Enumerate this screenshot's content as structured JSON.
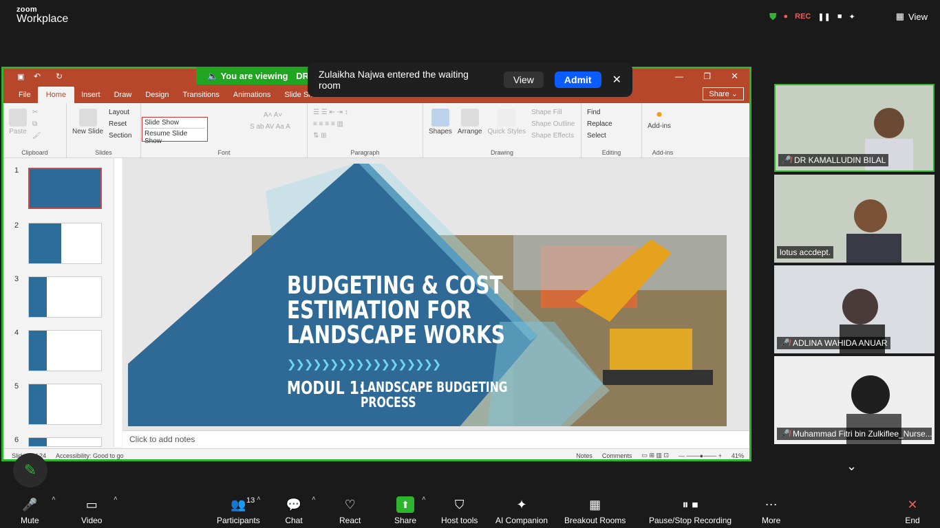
{
  "app": {
    "logo_line1": "zoom",
    "logo_line2": "Workplace"
  },
  "topbar": {
    "rec_label": "REC",
    "view_label": "View"
  },
  "banner": {
    "viewing_text": "You are viewing",
    "presenter_prefix": "DR"
  },
  "toast": {
    "message": "Zulaikha Najwa entered the waiting room",
    "view_label": "View",
    "admit_label": "Admit"
  },
  "ppt": {
    "tabs": [
      "File",
      "Home",
      "Insert",
      "Draw",
      "Design",
      "Transitions",
      "Animations",
      "Slide Show"
    ],
    "share_label": "Share",
    "ribbon": {
      "clipboard": {
        "paste": "Paste",
        "group": "Clipboard"
      },
      "slides": {
        "new_slide": "New Slide",
        "layout": "Layout",
        "reset": "Reset",
        "section": "Section",
        "group": "Slides"
      },
      "font": {
        "group": "Font"
      },
      "paragraph": {
        "group": "Paragraph"
      },
      "drawing": {
        "shapes": "Shapes",
        "arrange": "Arrange",
        "quick_styles": "Quick Styles",
        "shape_fill": "Shape Fill",
        "shape_outline": "Shape Outline",
        "shape_effects": "Shape Effects",
        "group": "Drawing"
      },
      "editing": {
        "find": "Find",
        "replace": "Replace",
        "select": "Select",
        "group": "Editing"
      },
      "addins": {
        "label": "Add-ins",
        "group": "Add-ins"
      }
    },
    "slideshow_popup": {
      "title": "Slide Show",
      "resume": "Resume Slide Show"
    },
    "thumbnails": [
      "1",
      "2",
      "3",
      "4",
      "5",
      "6"
    ],
    "slide": {
      "title_line1": "BUDGETING & COST",
      "title_line2": "ESTIMATION FOR",
      "title_line3": "LANDSCAPE WORKS",
      "chevrons": "❯❯❯❯❯❯❯❯❯❯❯❯❯❯❯❯❯❯",
      "modul": "MODUL 1:",
      "subtitle_line1": "LANDSCAPE BUDGETING",
      "subtitle_line2": "PROCESS"
    },
    "notes_placeholder": "Click to add notes",
    "status": {
      "slide": "Slide 1 of 24",
      "accessibility": "Accessibility: Good to go",
      "notes": "Notes",
      "comments": "Comments",
      "zoom": "41%"
    }
  },
  "participants_panel": [
    {
      "name": "DR KAMALLUDIN BILAL",
      "muted": true,
      "active": true
    },
    {
      "name": "lotus accdept.",
      "muted": false,
      "active": false
    },
    {
      "name": "ADLINA WAHIDA ANUAR",
      "muted": true,
      "active": false
    },
    {
      "name": "Muhammad Fitri bin Zulkiflee_Nurse...",
      "muted": true,
      "active": false
    }
  ],
  "toolbar": {
    "mute": "Mute",
    "video": "Video",
    "participants": "Participants",
    "participants_count": "13",
    "chat": "Chat",
    "react": "React",
    "share": "Share",
    "host_tools": "Host tools",
    "ai_companion": "AI Companion",
    "breakout": "Breakout Rooms",
    "recording": "Pause/Stop Recording",
    "more": "More",
    "end": "End"
  },
  "colors": {
    "share_border": "#2db52d",
    "ppt_red": "#b7472a",
    "admit_blue": "#0b5cff",
    "slide_blue": "#2c6e99"
  }
}
